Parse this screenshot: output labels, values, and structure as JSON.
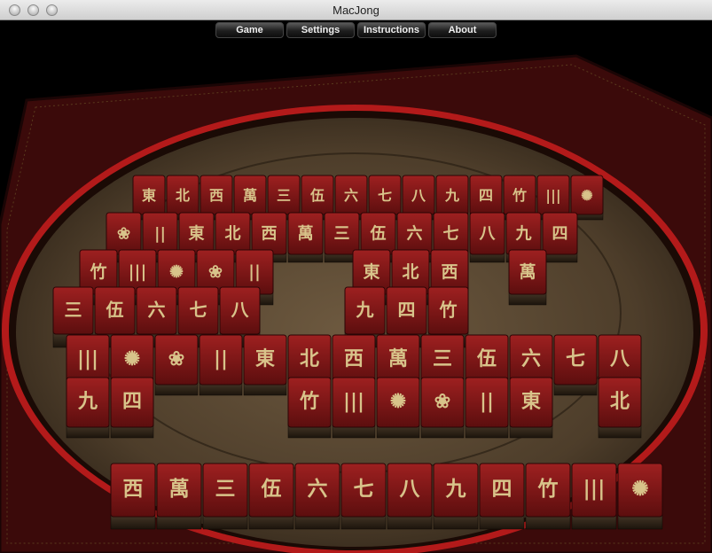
{
  "window": {
    "title": "MacJong"
  },
  "menu": {
    "items": [
      "Game",
      "Settings",
      "Instructions",
      "About"
    ]
  },
  "colors": {
    "tile_red": "#7a1414",
    "tile_edge": "#3a0a0a",
    "tile_glyph": "#d8c38a",
    "board_wood": "#5a4a36",
    "board_frame": "#4a0d0d",
    "ring_red": "#b31a1a"
  },
  "tiles": {
    "east": "東",
    "north": "北",
    "west": "西",
    "man": "萬",
    "three": "三",
    "five": "伍",
    "six": "六",
    "seven": "七",
    "eight": "八",
    "nine": "九",
    "four": "四",
    "bamboo_char": "竹"
  }
}
